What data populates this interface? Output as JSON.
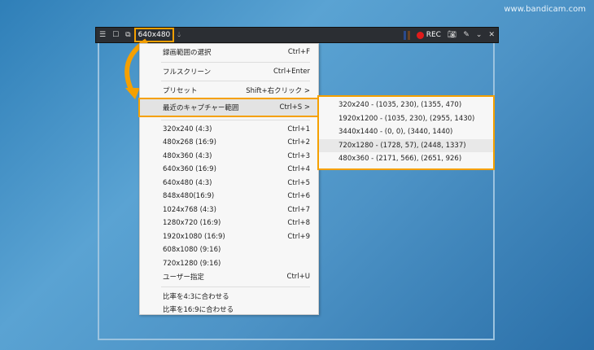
{
  "watermark": "www.bandicam.com",
  "toolbar": {
    "size": "640x480",
    "rec": "REC"
  },
  "menu": {
    "items": [
      {
        "label": "録画範囲の選択",
        "shortcut": "Ctrl+F"
      },
      {
        "label": "フルスクリーン",
        "shortcut": "Ctrl+Enter"
      },
      {
        "label": "プリセット",
        "shortcut": "Shift+右クリック >"
      },
      {
        "label": "最近のキャプチャー範囲",
        "shortcut": "Ctrl+S >"
      }
    ],
    "sizes": [
      {
        "label": "320x240 (4:3)",
        "shortcut": "Ctrl+1"
      },
      {
        "label": "480x268 (16:9)",
        "shortcut": "Ctrl+2"
      },
      {
        "label": "480x360 (4:3)",
        "shortcut": "Ctrl+3"
      },
      {
        "label": "640x360 (16:9)",
        "shortcut": "Ctrl+4"
      },
      {
        "label": "640x480 (4:3)",
        "shortcut": "Ctrl+5"
      },
      {
        "label": "848x480(16:9)",
        "shortcut": "Ctrl+6"
      },
      {
        "label": "1024x768 (4:3)",
        "shortcut": "Ctrl+7"
      },
      {
        "label": "1280x720 (16:9)",
        "shortcut": "Ctrl+8"
      },
      {
        "label": "1920x1080 (16:9)",
        "shortcut": "Ctrl+9"
      },
      {
        "label": "608x1080 (9:16)",
        "shortcut": ""
      },
      {
        "label": "720x1280 (9:16)",
        "shortcut": ""
      },
      {
        "label": "ユーザー指定",
        "shortcut": "Ctrl+U"
      }
    ],
    "ratio": [
      "比率を4:3に合わせる",
      "比率を16:9に合わせる"
    ]
  },
  "submenu": [
    "320x240 - (1035, 230), (1355, 470)",
    "1920x1200 - (1035, 230), (2955, 1430)",
    "3440x1440 - (0, 0), (3440, 1440)",
    "720x1280 - (1728, 57), (2448, 1337)",
    "480x360 - (2171, 566), (2651, 926)"
  ]
}
